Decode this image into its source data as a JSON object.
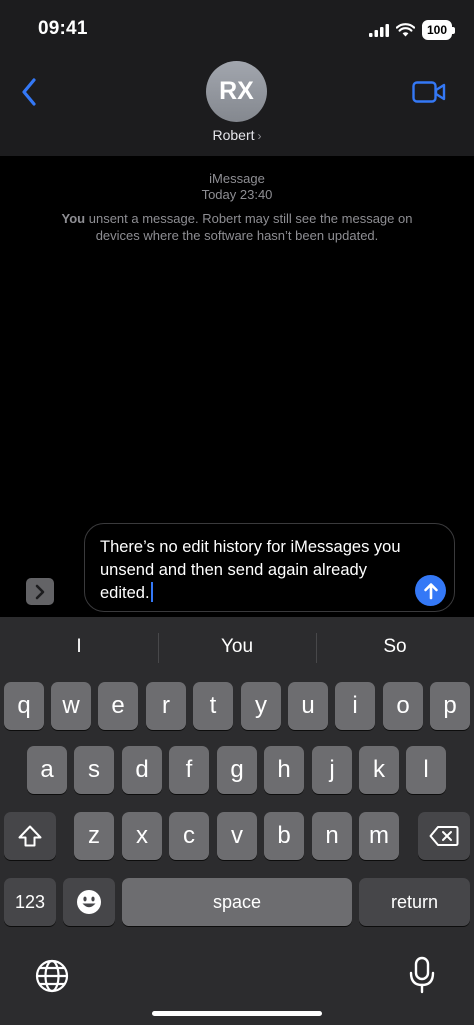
{
  "status": {
    "time": "09:41",
    "battery": "100"
  },
  "header": {
    "avatar_initials": "RX",
    "contact_name": "Robert",
    "chevron": "›"
  },
  "conversation": {
    "service": "iMessage",
    "timestamp": "Today 23:40",
    "notice_you": "You",
    "notice_text": " unsent a message. Robert may still see the message on devices where the software hasn’t been updated."
  },
  "composer": {
    "text": "There’s no edit history for iMessages you unsend and then send again already edited."
  },
  "keyboard": {
    "predictions": [
      "I",
      "You",
      "So"
    ],
    "row1": [
      "q",
      "w",
      "e",
      "r",
      "t",
      "y",
      "u",
      "i",
      "o",
      "p"
    ],
    "row2": [
      "a",
      "s",
      "d",
      "f",
      "g",
      "h",
      "j",
      "k",
      "l"
    ],
    "row3": [
      "z",
      "x",
      "c",
      "v",
      "b",
      "n",
      "m"
    ],
    "numbers_label": "123",
    "space_label": "space",
    "return_label": "return"
  },
  "icons": {
    "back": "chevron-left-icon",
    "video": "video-camera-icon",
    "apps": "chevron-right-icon",
    "send": "arrow-up-icon",
    "shift": "shift-icon",
    "delete": "delete-backspace-icon",
    "emoji": "emoji-icon",
    "globe": "globe-icon",
    "mic": "microphone-icon"
  },
  "colors": {
    "accent": "#3478f6",
    "header_bg": "#1c1c1e",
    "keyboard_bg": "#2c2c2e"
  }
}
